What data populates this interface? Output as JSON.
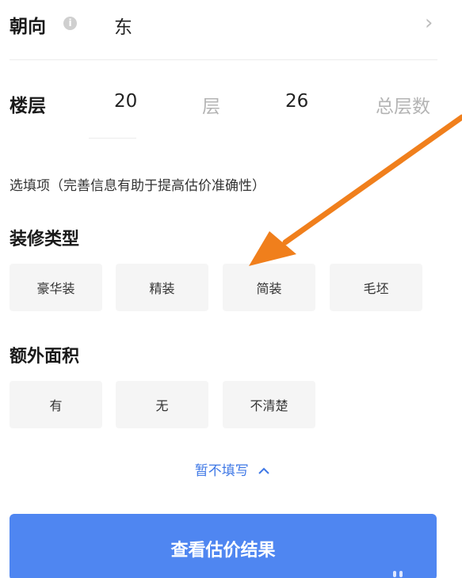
{
  "orientation": {
    "label": "朝向",
    "value": "东"
  },
  "floor": {
    "label": "楼层",
    "floor_value": "20",
    "floor_unit": "层",
    "total_value": "26",
    "total_unit": "总层数"
  },
  "optional_hint": "选填项（完善信息有助于提高估价准确性）",
  "decoration": {
    "title": "装修类型",
    "options": [
      "豪华装",
      "精装",
      "简装",
      "毛坯"
    ]
  },
  "extra_area": {
    "title": "额外面积",
    "options": [
      "有",
      "无",
      "不清楚"
    ]
  },
  "collapse_label": "暂不填写",
  "submit_label": "查看估价结果",
  "colors": {
    "accent": "#4f86f1",
    "link": "#3f78e6",
    "annotation_arrow": "#f07f1c",
    "chip_bg": "#f5f5f5"
  },
  "icons": {
    "info": "info-icon",
    "chevron": "chevron-right-icon",
    "collapse": "chevron-up-icon",
    "annotation": "arrow-annotation"
  }
}
